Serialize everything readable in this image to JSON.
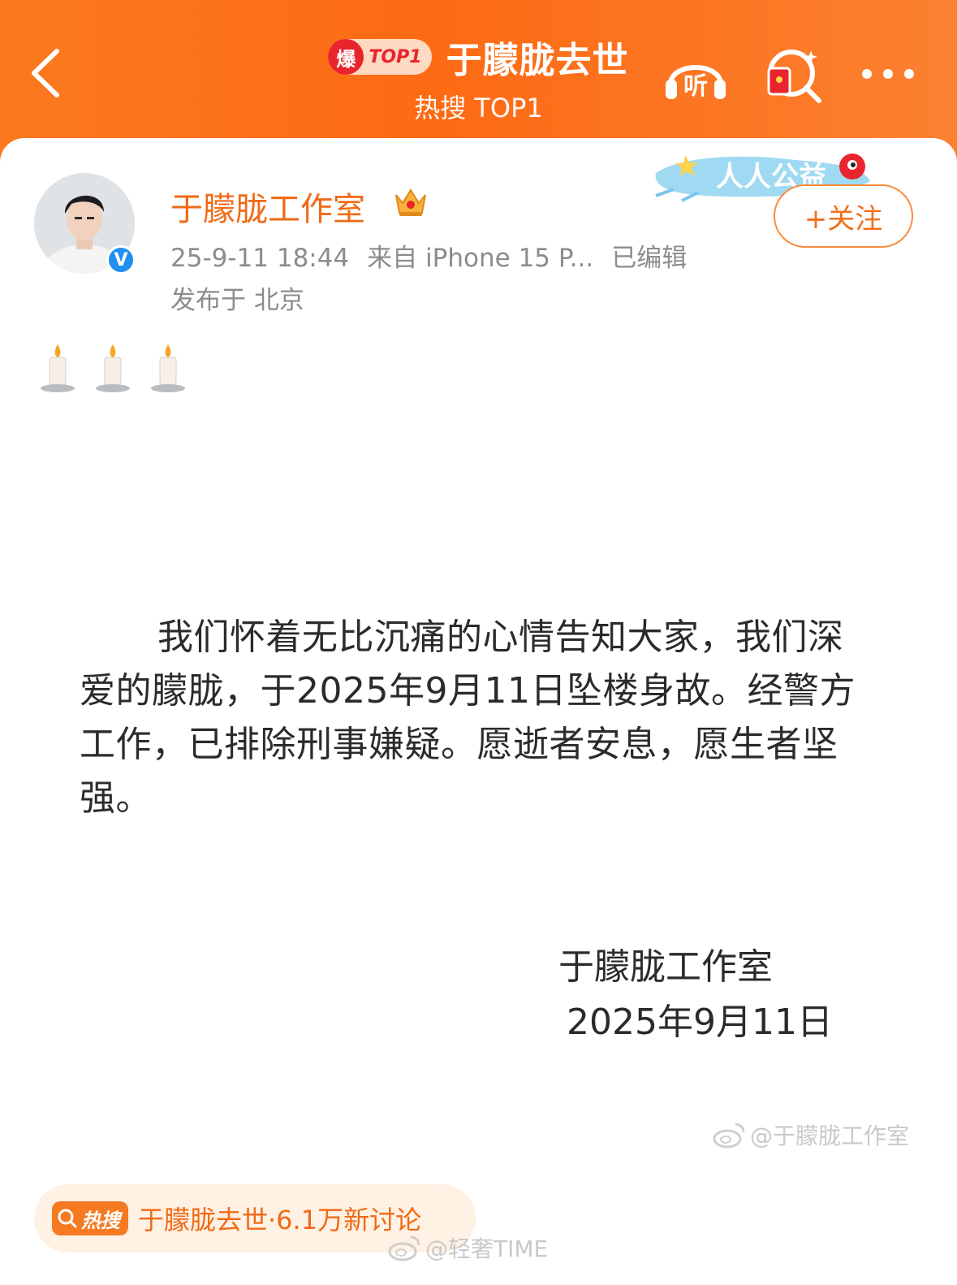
{
  "header": {
    "badge_char": "爆",
    "badge_rank": "TOP1",
    "title": "于朦胧去世",
    "subtitle": "热搜 TOP1",
    "listen_label": "听"
  },
  "post": {
    "author": "于朦胧工作室",
    "verified_mark": "V",
    "time": "25-9-11 18:44",
    "source": "来自 iPhone 15 P...",
    "edited": "已编辑",
    "location": "发布于 北京",
    "banner_text": "人人公益",
    "follow_label": "+关注",
    "statement": "我们怀着无比沉痛的心情告知大家，我们深爱的朦胧，于2025年9月11日坠楼身故。经警方工作，已排除刑事嫌疑。愿逝者安息，愿生者坚强。",
    "signature_name": "于朦胧工作室",
    "signature_date": "2025年9月11日",
    "watermark_image": "@于朦胧工作室"
  },
  "hot_topic": {
    "badge": "热搜",
    "text": "于朦胧去世·6.1万新讨论"
  },
  "watermark": "@轻奢TIME",
  "colors": {
    "header_orange": "#fd6a14",
    "name_orange": "#f06a16",
    "meta_gray": "#8c8c8c",
    "verified_blue": "#1f8ff0"
  }
}
